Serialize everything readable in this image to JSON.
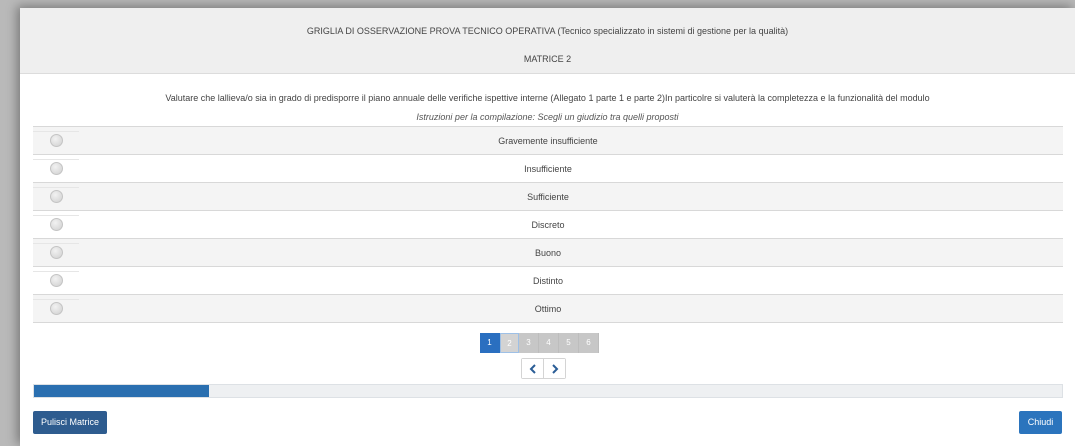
{
  "header": {
    "title": "GRIGLIA DI OSSERVAZIONE PROVA TECNICO OPERATIVA (Tecnico specializzato in sistemi di gestione per la qualità)",
    "subtitle": "MATRICE 2"
  },
  "question": {
    "description": "Valutare che lallieva/o sia in grado di predisporre il piano annuale delle verifiche ispettive interne (Allegato 1 parte 1 e parte 2)In particolre si valuterà la completezza e la funzionalità del modulo",
    "instructions": "Istruzioni per la compilazione: Scegli un giudizio tra quelli proposti"
  },
  "options": [
    {
      "label": "Gravemente insufficiente"
    },
    {
      "label": "Insufficiente"
    },
    {
      "label": "Sufficiente"
    },
    {
      "label": "Discreto"
    },
    {
      "label": "Buono"
    },
    {
      "label": "Distinto"
    },
    {
      "label": "Ottimo"
    }
  ],
  "pagination": {
    "pages": [
      "1",
      "2",
      "3",
      "4",
      "5",
      "6"
    ],
    "current": "1",
    "prev_icon": "chevron-left-icon",
    "next_icon": "chevron-right-icon"
  },
  "progress": {
    "value_fraction": 0.17
  },
  "footer": {
    "clear_label": "Pulisci Matrice",
    "close_label": "Chiudi"
  },
  "colors": {
    "primary": "#2a6fc0",
    "clear_button": "#2e5c8f",
    "progress_fill": "#2a6fb0"
  }
}
